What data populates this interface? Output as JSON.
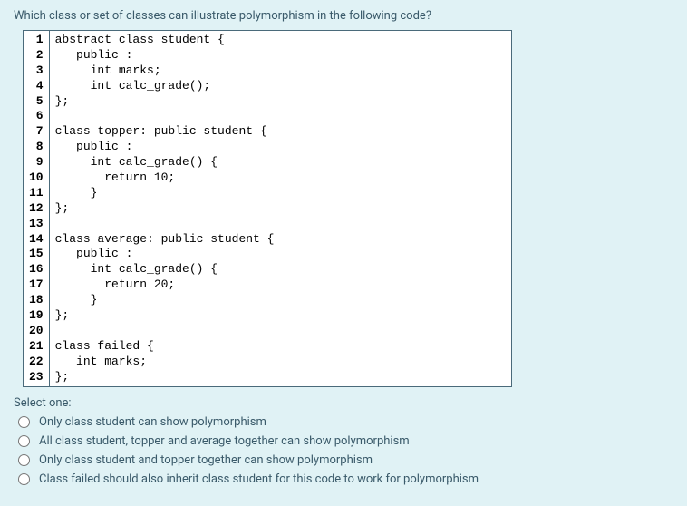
{
  "question": "Which class or set of classes can illustrate polymorphism in the following code?",
  "code": {
    "lines": [
      {
        "num": "1",
        "text": "abstract class student {"
      },
      {
        "num": "2",
        "text": "   public :"
      },
      {
        "num": "3",
        "text": "     int marks;"
      },
      {
        "num": "4",
        "text": "     int calc_grade();"
      },
      {
        "num": "5",
        "text": "};"
      },
      {
        "num": "6",
        "text": ""
      },
      {
        "num": "7",
        "text": "class topper: public student {"
      },
      {
        "num": "8",
        "text": "   public :"
      },
      {
        "num": "9",
        "text": "     int calc_grade() {"
      },
      {
        "num": "10",
        "text": "       return 10;"
      },
      {
        "num": "11",
        "text": "     }"
      },
      {
        "num": "12",
        "text": "};"
      },
      {
        "num": "13",
        "text": ""
      },
      {
        "num": "14",
        "text": "class average: public student {"
      },
      {
        "num": "15",
        "text": "   public :"
      },
      {
        "num": "16",
        "text": "     int calc_grade() {"
      },
      {
        "num": "17",
        "text": "       return 20;"
      },
      {
        "num": "18",
        "text": "     }"
      },
      {
        "num": "19",
        "text": "};"
      },
      {
        "num": "20",
        "text": ""
      },
      {
        "num": "21",
        "text": "class failed {"
      },
      {
        "num": "22",
        "text": "   int marks;"
      },
      {
        "num": "23",
        "text": "};"
      }
    ]
  },
  "select_prompt": "Select one:",
  "options": [
    {
      "label": "Only class student can show polymorphism"
    },
    {
      "label": "All class student, topper and average together can show polymorphism"
    },
    {
      "label": "Only class student and topper together can show polymorphism"
    },
    {
      "label": "Class failed should also inherit class student for this code to work for polymorphism"
    }
  ]
}
